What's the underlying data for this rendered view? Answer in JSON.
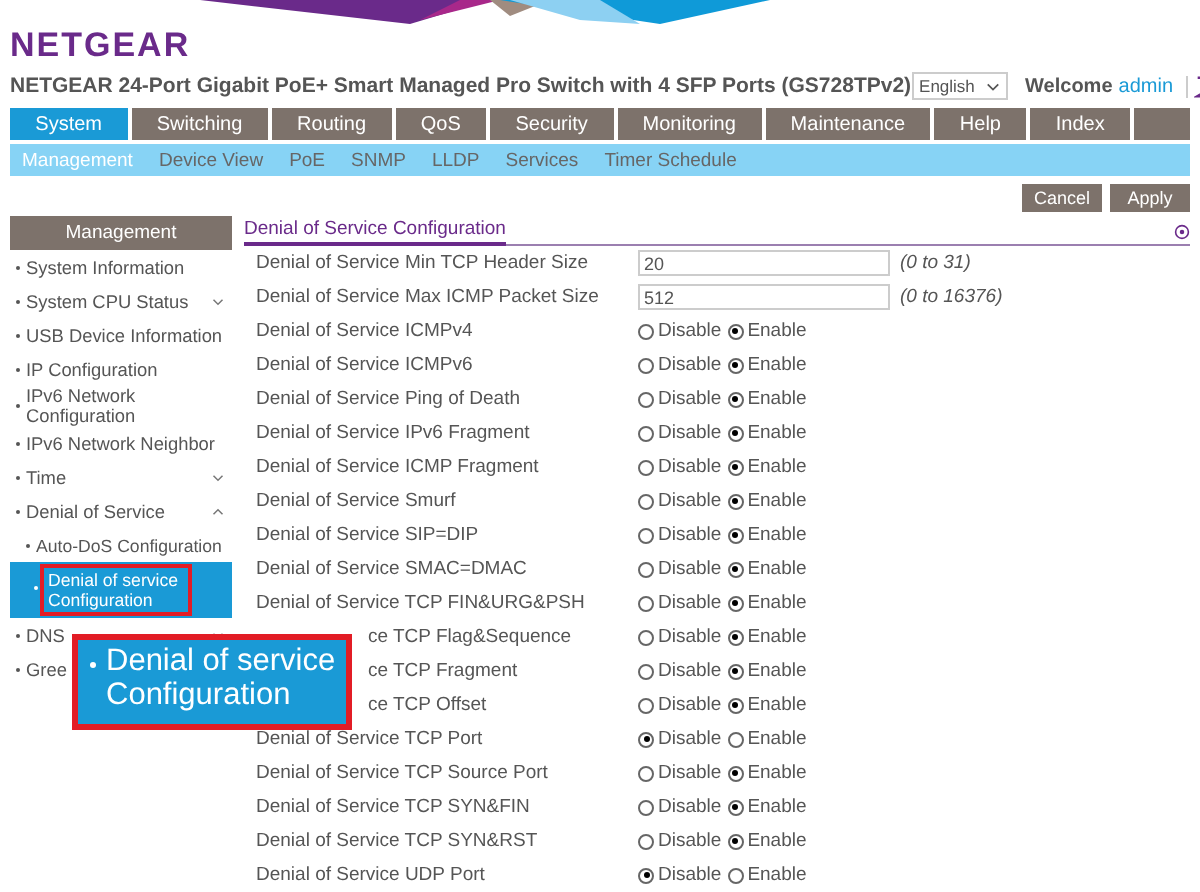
{
  "logo": "NETGEAR",
  "title": "NETGEAR 24-Port Gigabit PoE+ Smart Managed Pro Switch with 4 SFP Ports (GS728TPv2)",
  "language": "English",
  "welcome": {
    "label": "Welcome",
    "user": "admin"
  },
  "tabs": [
    {
      "label": "System",
      "selected": true
    },
    {
      "label": "Switching",
      "selected": false
    },
    {
      "label": "Routing",
      "selected": false
    },
    {
      "label": "QoS",
      "selected": false
    },
    {
      "label": "Security",
      "selected": false
    },
    {
      "label": "Monitoring",
      "selected": false
    },
    {
      "label": "Maintenance",
      "selected": false
    },
    {
      "label": "Help",
      "selected": false
    },
    {
      "label": "Index",
      "selected": false
    }
  ],
  "subtabs": [
    {
      "label": "Management",
      "selected": true
    },
    {
      "label": "Device View",
      "selected": false
    },
    {
      "label": "PoE",
      "selected": false
    },
    {
      "label": "SNMP",
      "selected": false
    },
    {
      "label": "LLDP",
      "selected": false
    },
    {
      "label": "Services",
      "selected": false
    },
    {
      "label": "Timer Schedule",
      "selected": false
    }
  ],
  "buttons": [
    "Cancel",
    "Apply"
  ],
  "sidebar": {
    "title": "Management",
    "items": [
      {
        "label": "System Information",
        "selected": false
      },
      {
        "label": "System CPU Status",
        "selected": false,
        "expanded": false
      },
      {
        "label": "USB Device Information",
        "selected": false
      },
      {
        "label": "IP Configuration",
        "selected": false
      },
      {
        "label": "IPv6 Network Configuration",
        "selected": false
      },
      {
        "label": "IPv6 Network Neighbor",
        "selected": false
      },
      {
        "label": "Time",
        "selected": false,
        "expanded": false
      },
      {
        "label": "Denial of Service",
        "selected": false,
        "expanded": true,
        "children": [
          {
            "label": "Auto-DoS Configuration",
            "selected": false
          },
          {
            "label": "Denial of service Configuration",
            "selected": true
          }
        ]
      },
      {
        "label": "DNS",
        "selected": false,
        "expanded": false
      },
      {
        "label": "Gree",
        "selected": false
      }
    ]
  },
  "callout": "Denial of service Configuration",
  "section_title": "Denial of Service Configuration",
  "rows": [
    {
      "label": "Denial of Service Min TCP Header Size",
      "kind": "number",
      "value": "20",
      "range": "(0 to 31)"
    },
    {
      "label": "Denial of Service Max ICMP Packet Size",
      "kind": "number",
      "value": "512",
      "range": "(0 to 16376)"
    },
    {
      "label": "Denial of Service ICMPv4",
      "kind": "radio",
      "options": [
        {
          "label": "Disable",
          "selected": false
        },
        {
          "label": "Enable",
          "selected": true
        }
      ]
    },
    {
      "label": "Denial of Service ICMPv6",
      "kind": "radio",
      "options": [
        {
          "label": "Disable",
          "selected": false
        },
        {
          "label": "Enable",
          "selected": true
        }
      ]
    },
    {
      "label": "Denial of Service Ping of Death",
      "kind": "radio",
      "options": [
        {
          "label": "Disable",
          "selected": false
        },
        {
          "label": "Enable",
          "selected": true
        }
      ]
    },
    {
      "label": "Denial of Service IPv6 Fragment",
      "kind": "radio",
      "options": [
        {
          "label": "Disable",
          "selected": false
        },
        {
          "label": "Enable",
          "selected": true
        }
      ]
    },
    {
      "label": "Denial of Service ICMP Fragment",
      "kind": "radio",
      "options": [
        {
          "label": "Disable",
          "selected": false
        },
        {
          "label": "Enable",
          "selected": true
        }
      ]
    },
    {
      "label": "Denial of Service Smurf",
      "kind": "radio",
      "options": [
        {
          "label": "Disable",
          "selected": false
        },
        {
          "label": "Enable",
          "selected": true
        }
      ]
    },
    {
      "label": "Denial of Service SIP=DIP",
      "kind": "radio",
      "options": [
        {
          "label": "Disable",
          "selected": false
        },
        {
          "label": "Enable",
          "selected": true
        }
      ]
    },
    {
      "label": "Denial of Service SMAC=DMAC",
      "kind": "radio",
      "options": [
        {
          "label": "Disable",
          "selected": false
        },
        {
          "label": "Enable",
          "selected": true
        }
      ]
    },
    {
      "label": "Denial of Service TCP FIN&URG&PSH",
      "kind": "radio",
      "options": [
        {
          "label": "Disable",
          "selected": false
        },
        {
          "label": "Enable",
          "selected": true
        }
      ]
    },
    {
      "label": "ce TCP Flag&Sequence",
      "kind": "radio",
      "covered": true,
      "options": [
        {
          "label": "Disable",
          "selected": false
        },
        {
          "label": "Enable",
          "selected": true
        }
      ]
    },
    {
      "label": "ce TCP Fragment",
      "kind": "radio",
      "covered": true,
      "options": [
        {
          "label": "Disable",
          "selected": false
        },
        {
          "label": "Enable",
          "selected": true
        }
      ]
    },
    {
      "label": "ce TCP Offset",
      "kind": "radio",
      "covered": true,
      "options": [
        {
          "label": "Disable",
          "selected": false
        },
        {
          "label": "Enable",
          "selected": true
        }
      ]
    },
    {
      "label": "Denial of Service TCP Port",
      "kind": "radio",
      "options": [
        {
          "label": "Disable",
          "selected": true
        },
        {
          "label": "Enable",
          "selected": false
        }
      ]
    },
    {
      "label": "Denial of Service TCP Source Port",
      "kind": "radio",
      "options": [
        {
          "label": "Disable",
          "selected": false
        },
        {
          "label": "Enable",
          "selected": true
        }
      ]
    },
    {
      "label": "Denial of Service TCP SYN&FIN",
      "kind": "radio",
      "options": [
        {
          "label": "Disable",
          "selected": false
        },
        {
          "label": "Enable",
          "selected": true
        }
      ]
    },
    {
      "label": "Denial of Service TCP SYN&RST",
      "kind": "radio",
      "options": [
        {
          "label": "Disable",
          "selected": false
        },
        {
          "label": "Enable",
          "selected": true
        }
      ]
    },
    {
      "label": "Denial of Service UDP Port",
      "kind": "radio",
      "options": [
        {
          "label": "Disable",
          "selected": true
        },
        {
          "label": "Enable",
          "selected": false
        }
      ]
    }
  ]
}
